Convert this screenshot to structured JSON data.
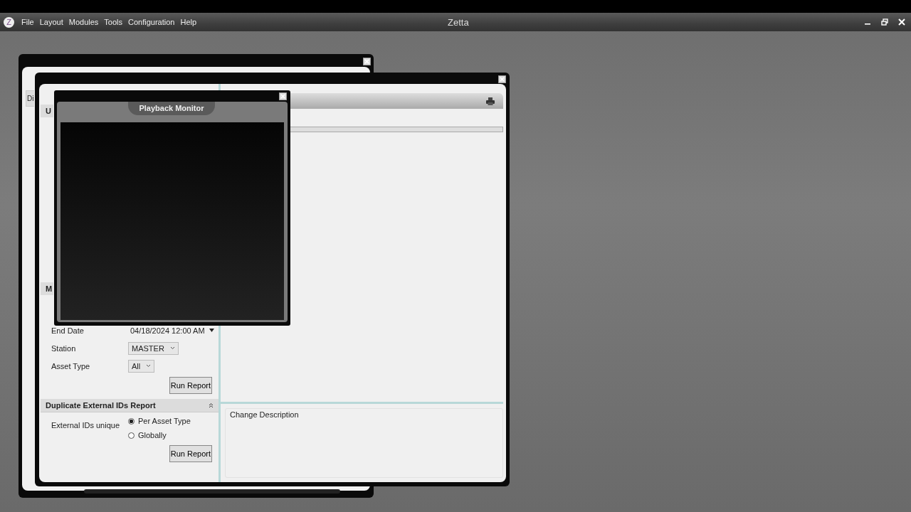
{
  "app": {
    "logo": "Z",
    "menu": [
      "File",
      "Layout",
      "Modules",
      "Tools",
      "Configuration",
      "Help"
    ],
    "title": "Zetta"
  },
  "media_window": {
    "tab": "Di"
  },
  "report_window": {
    "section_1": {
      "title": "U"
    },
    "section_2": {
      "title": "M",
      "end_date": {
        "label": "End Date",
        "value": "04/18/2024 12:00 AM"
      },
      "station": {
        "label": "Station",
        "value": "MASTER"
      },
      "asset_type": {
        "label": "Asset Type",
        "value": "All"
      },
      "run_button": "Run Report"
    },
    "section_3": {
      "title": "Duplicate External IDs Report",
      "expanded": true,
      "label": "External IDs unique",
      "options": [
        {
          "label": "Per Asset Type",
          "selected": true
        },
        {
          "label": "Globally",
          "selected": false
        }
      ],
      "run_button": "Run Report"
    },
    "progress": {
      "level": 0
    },
    "change_description": {
      "title": "Change Description"
    }
  },
  "playback_monitor": {
    "title": "Playback Monitor"
  }
}
